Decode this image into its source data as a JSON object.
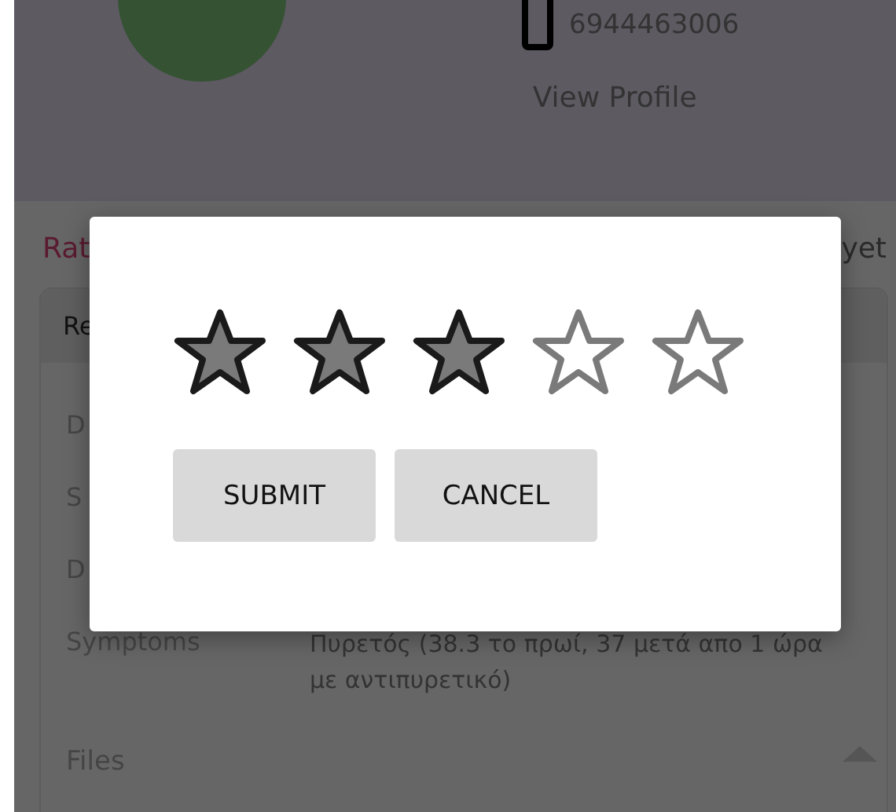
{
  "profile": {
    "phone": "6944463006",
    "link": "View Profile"
  },
  "section": {
    "left_label": "Rat",
    "right_label": "yet"
  },
  "card": {
    "title": "Re",
    "rows": [
      {
        "label": "D"
      },
      {
        "label": "S"
      },
      {
        "label": "D"
      },
      {
        "label": "Symptoms",
        "value": "Πυρετός (38.3 το πρωί, 37 μετά απο 1 ώρα με αντιπυρετικό)"
      }
    ],
    "footer": "Files"
  },
  "dialog": {
    "stars": 3,
    "buttons": [
      "SUBMIT",
      "CANCEL"
    ]
  }
}
